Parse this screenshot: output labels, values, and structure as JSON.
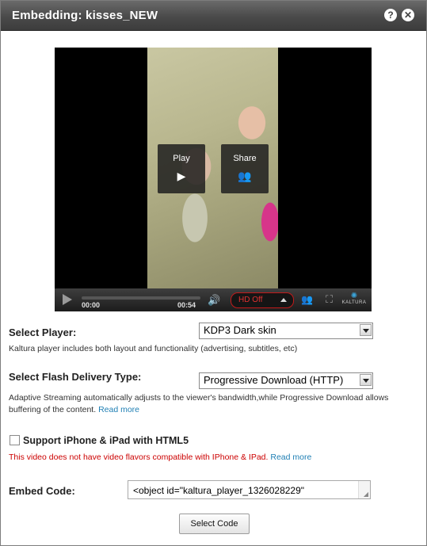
{
  "dialog": {
    "title": "Embedding: kisses_NEW",
    "help_icon": "?",
    "close_icon": "✕"
  },
  "player": {
    "overlay_play_label": "Play",
    "overlay_share_label": "Share",
    "time_current": "00:00",
    "time_total": "00:54",
    "hd_label": "HD Off",
    "logo_text": "KALTURA",
    "icons": [
      "play-icon",
      "share-icon",
      "volume-icon",
      "fullscreen-icon",
      "kaltura-logo-icon"
    ]
  },
  "select_player": {
    "label": "Select Player:",
    "value": "KDP3 Dark skin",
    "description": "Kaltura player includes both layout and functionality (advertising, subtitles, etc)"
  },
  "flash_delivery": {
    "label": "Select Flash Delivery Type:",
    "value": "Progressive Download (HTTP)",
    "description": "Adaptive Streaming automatically adjusts to the viewer's bandwidth,while Progressive Download allows buffering of the content.",
    "read_more": "Read more"
  },
  "html5": {
    "label": "Support iPhone & iPad with HTML5",
    "checked": false,
    "warning": "This video does not have video flavors compatible with IPhone & IPad.",
    "read_more": "Read more"
  },
  "embed": {
    "label": "Embed Code:",
    "value": "<object id=\"kaltura_player_1326028229\"",
    "button_label": "Select Code"
  },
  "colors": {
    "titlebar": "#4a4a4a",
    "link": "#1f7fb4",
    "warning": "#cc0000",
    "hd_accent": "#c21a1a"
  }
}
